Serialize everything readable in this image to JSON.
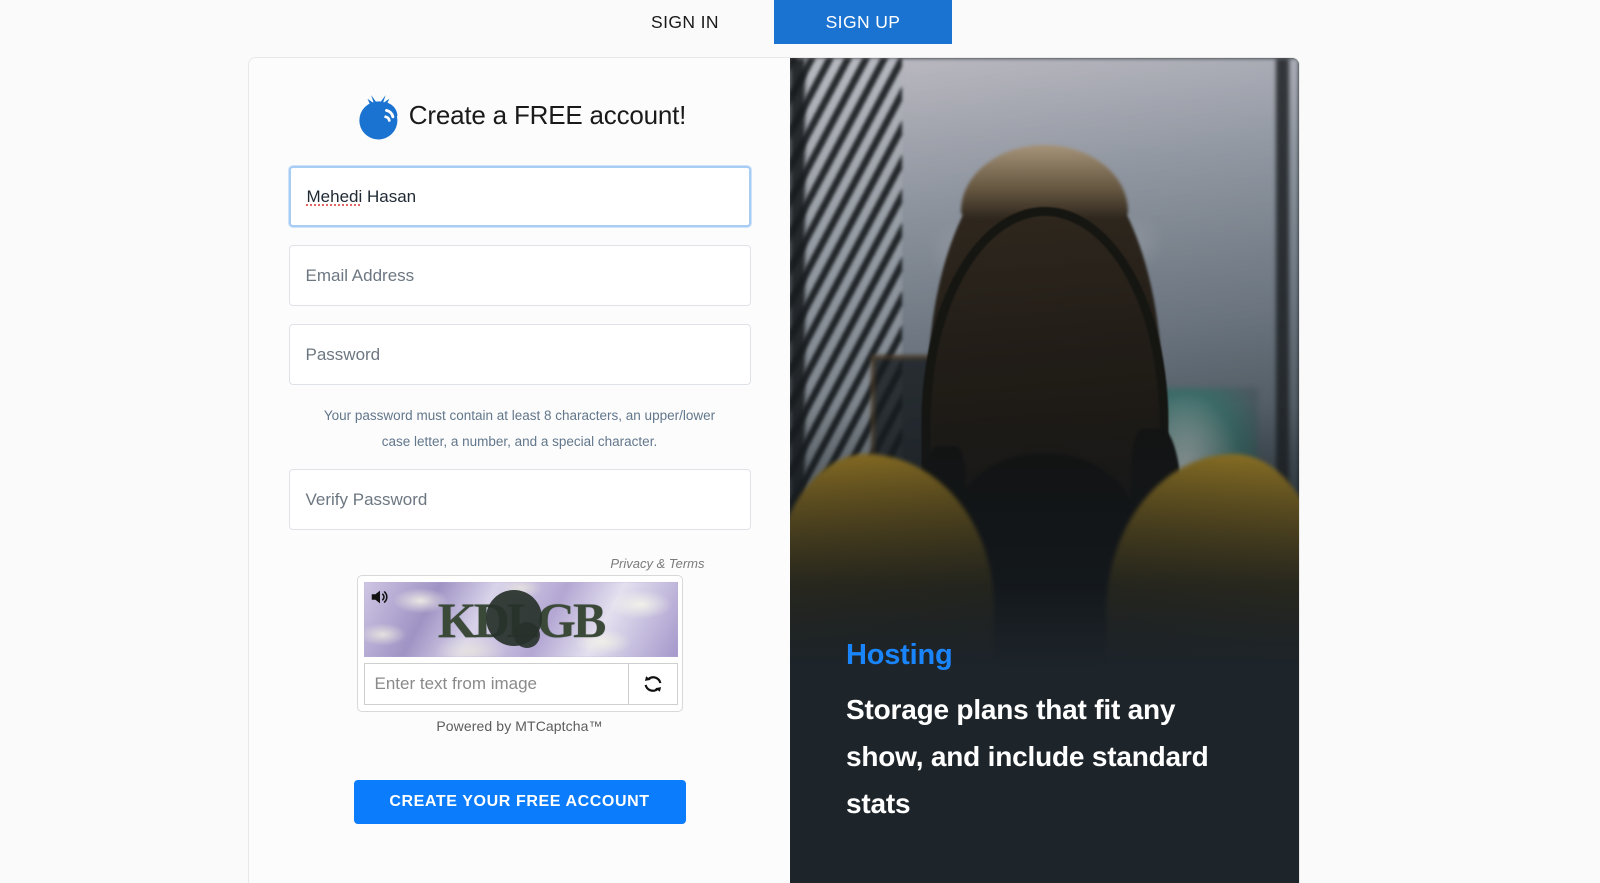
{
  "tabs": [
    {
      "label": "SIGN IN",
      "active": false
    },
    {
      "label": "SIGN UP",
      "active": true
    }
  ],
  "brand": {
    "title": "Create a FREE account!",
    "logo_icon": "blueberry-podcast-icon"
  },
  "form": {
    "name_value": "Mehedi",
    "name_value_rest": " Hasan",
    "email_placeholder": "Email Address",
    "password_placeholder": "Password",
    "password_hint": "Your password must contain at least 8 characters, an upper/lower case letter, a number, and a special character.",
    "verify_placeholder": "Verify Password",
    "submit_label": "CREATE YOUR FREE ACCOUNT"
  },
  "captcha": {
    "privacy_terms": "Privacy & Terms",
    "code_text": "KDLGB",
    "input_placeholder": "Enter text from image",
    "powered_by": "Powered by MTCaptcha™",
    "audio_icon": "speaker-icon",
    "refresh_icon": "refresh-icon"
  },
  "hero": {
    "kicker": "Hosting",
    "headline": "Storage plans that fit any show, and include standard stats"
  },
  "colors": {
    "tab_active_blue": "#1a73d1",
    "cta_blue": "#0b7cfb",
    "kicker_blue": "#1a85fb",
    "hero_bg": "#1d242a",
    "page_bg": "#fafafa"
  }
}
